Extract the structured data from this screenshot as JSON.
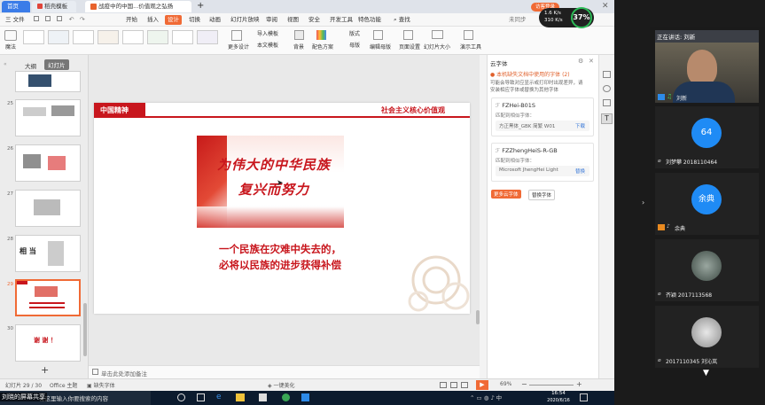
{
  "wps": {
    "tabs": {
      "home": "首页",
      "templates": "稻壳模板",
      "document": "战疫中的中国...价值观之弘扬"
    },
    "add_tab": "+",
    "right_tab_user": "访客登录",
    "net_speed_up": "1.6 K/s",
    "net_speed_down": "310 K/s",
    "cpu_percent": "37%",
    "menu": {
      "file": "三 文件",
      "items": [
        "开始",
        "插入",
        "设计",
        "切换",
        "动画",
        "幻灯片放映",
        "审阅",
        "视图",
        "安全",
        "开发工具",
        "特色功能"
      ],
      "active": "设计",
      "search": "查找",
      "sync": "未同步",
      "collab": "协作",
      "share": "分享"
    },
    "toolbar": {
      "magic": "魔法",
      "more_design": "更多设计",
      "import_template": "导入模板",
      "master": "本文模板",
      "background": "背景",
      "color_scheme": "配色方案",
      "format": "版式",
      "template": "母版",
      "edit_master": "编辑母版",
      "page_setup": "页面设置",
      "slide_size": "幻灯片大小",
      "presentation_tools": "演示工具"
    },
    "left_panel": {
      "outline_tab": "大纲",
      "slides_tab": "幻灯片",
      "slide_numbers": [
        "25",
        "26",
        "27",
        "28",
        "29",
        "30"
      ],
      "thumb_28_text": "相 当",
      "thumb_30_text": "谢 谢 ！",
      "add_slide": "+"
    },
    "slide": {
      "badge": "中国精神",
      "header_right": "社会主义核心价值观",
      "calligraphy_line1": "为伟大的中华民族",
      "calligraphy_line2": "复兴而努力",
      "body_line1": "一个民族在灾难中失去的，",
      "body_line2": "必将以民族的进步获得补偿"
    },
    "notes_placeholder": "单击此处添加备注",
    "right_panel": {
      "title": "云字体",
      "warning": "本机缺失文档中使用的字体 (2)",
      "description": "可能会导致对应显示或打印时出现差异，请安装相应字体或替换为其他字体",
      "font1_name": "FZHei-B01S",
      "font1_match": "匹配到相似字体：",
      "font1_candidate": "方正黑体_GBK 简繁 W01",
      "font1_action": "下载",
      "font2_name": "FZZhengHeiS-R-GB",
      "font2_match": "匹配到相似字体：",
      "font2_candidate": "Microsoft JhengHei Light",
      "font2_action": "替换",
      "btn_more": "更多云字体",
      "btn_replace": "替换字体"
    },
    "status": {
      "slide_counter": "幻灯片 29 / 30",
      "theme": "Office 主题",
      "font_missing": "缺失字体",
      "beautify": "一键美化",
      "zoom": "69%",
      "zoom_minus": "−",
      "zoom_plus": "+"
    }
  },
  "taskbar": {
    "search_placeholder": "在这里输入你要搜索的内容",
    "time": "16:54",
    "date": "2020/6/16",
    "overlay_text": "刘晓的屏幕共享"
  },
  "video_panel": {
    "speaking": "正在讲话: 刘新",
    "tiles": [
      {
        "label": "刘新",
        "avatar_text": ""
      },
      {
        "label": "刘梦攀 2018110464",
        "avatar_text": "64"
      },
      {
        "label": "余典",
        "avatar_text": "余典"
      },
      {
        "label": "齐颖 2017113568",
        "avatar_text": ""
      },
      {
        "label": "2017110345 刘沁岚",
        "avatar_text": ""
      }
    ],
    "colors": {
      "blue_avatar": "#1f8bf5",
      "slide_red": "#c8161d",
      "wps_orange": "#f06a35"
    }
  }
}
